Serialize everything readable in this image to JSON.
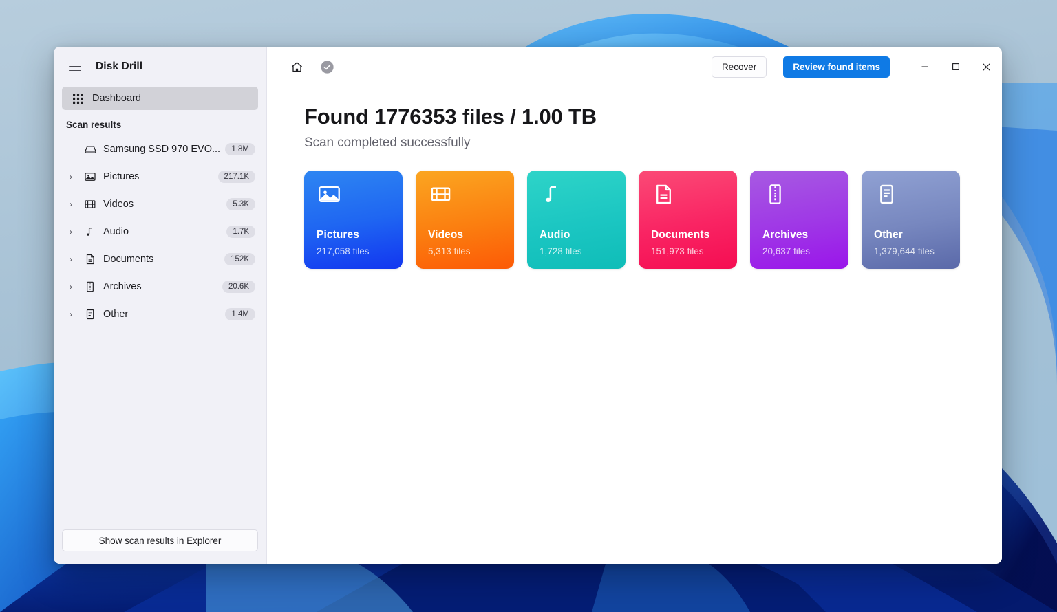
{
  "window": {
    "app_title": "Disk Drill",
    "menu_icon": "hamburger-icon"
  },
  "sidebar": {
    "dashboard": {
      "label": "Dashboard",
      "icon": "grid-dots-icon"
    },
    "section_label": "Scan results",
    "tree_items": [
      {
        "label": "Samsung SSD 970 EVO...",
        "badge": "1.8M",
        "icon": "hard-drive-icon",
        "expandable": false
      },
      {
        "label": "Pictures",
        "badge": "217.1K",
        "icon": "image-icon",
        "expandable": true
      },
      {
        "label": "Videos",
        "badge": "5.3K",
        "icon": "film-icon",
        "expandable": true
      },
      {
        "label": "Audio",
        "badge": "1.7K",
        "icon": "music-note-icon",
        "expandable": true
      },
      {
        "label": "Documents",
        "badge": "152K",
        "icon": "document-icon",
        "expandable": true
      },
      {
        "label": "Archives",
        "badge": "20.6K",
        "icon": "zip-icon",
        "expandable": true
      },
      {
        "label": "Other",
        "badge": "1.4M",
        "icon": "file-lines-icon",
        "expandable": true
      }
    ],
    "footer_button": "Show scan results in Explorer"
  },
  "toolbar": {
    "home_icon": "home-icon",
    "status_icon": "check-circle-icon",
    "recover_label": "Recover",
    "review_label": "Review found items",
    "minimize": "–",
    "maximize": "□",
    "close": "✕"
  },
  "main": {
    "headline": "Found 1776353 files / 1.00 TB",
    "subline": "Scan completed successfully",
    "cards": [
      {
        "title": "Pictures",
        "count": "217,058 files",
        "icon": "image-icon",
        "color_from": "#2e86f2",
        "color_to": "#1236f0"
      },
      {
        "title": "Videos",
        "count": "5,313 files",
        "icon": "film-icon",
        "color_from": "#fba621",
        "color_to": "#fc5a06"
      },
      {
        "title": "Audio",
        "count": "1,728 files",
        "icon": "music-note-icon",
        "color_from": "#2ed4c8",
        "color_to": "#0fbdb8"
      },
      {
        "title": "Documents",
        "count": "151,973 files",
        "icon": "document-icon",
        "color_from": "#fb4a76",
        "color_to": "#f50d52"
      },
      {
        "title": "Archives",
        "count": "20,637 files",
        "icon": "zip-icon",
        "color_from": "#a75ae2",
        "color_to": "#9a15ea"
      },
      {
        "title": "Other",
        "count": "1,379,644 files",
        "icon": "file-lines-icon",
        "color_from": "#90a1d3",
        "color_to": "#5a69a9"
      }
    ]
  },
  "theme": {
    "accent": "#0f7ae5",
    "sidebar_bg": "#f1f1f7",
    "active_item_bg": "#d2d2d8",
    "badge_bg": "#dedee6"
  }
}
